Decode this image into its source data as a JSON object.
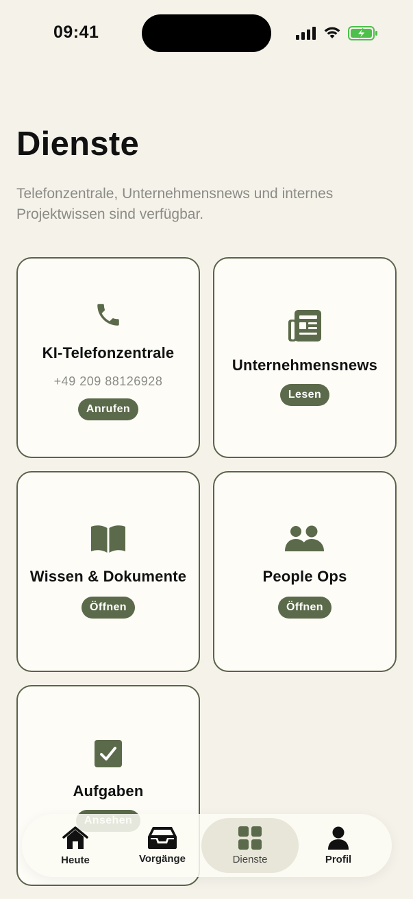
{
  "status_bar": {
    "time": "09:41"
  },
  "header": {
    "title": "Dienste",
    "subtitle": "Telefonzentrale, Unternehmensnews und internes Projektwissen sind verfügbar."
  },
  "cards": [
    {
      "title": "KI-Telefonzentrale",
      "subtitle": "+49 209 88126928",
      "action": "Anrufen",
      "icon": "phone-icon"
    },
    {
      "title": "Unternehmensnews",
      "action": "Lesen",
      "icon": "newspaper-icon"
    },
    {
      "title": "Wissen & Dokumente",
      "action": "Öffnen",
      "icon": "book-icon"
    },
    {
      "title": "People Ops",
      "action": "Öffnen",
      "icon": "users-icon"
    },
    {
      "title": "Aufgaben",
      "action": "Ansehen",
      "icon": "checkbox-icon"
    }
  ],
  "tabbar": {
    "items": [
      {
        "label": "Heute",
        "icon": "home-icon"
      },
      {
        "label": "Vorgänge",
        "icon": "inbox-icon"
      },
      {
        "label": "Dienste",
        "icon": "grid-icon",
        "active": true
      },
      {
        "label": "Profil",
        "icon": "person-icon"
      }
    ]
  },
  "colors": {
    "background": "#f5f2ea",
    "accent": "#5b6a4a",
    "card": "#fdfcf7",
    "border": "#5b6249"
  }
}
